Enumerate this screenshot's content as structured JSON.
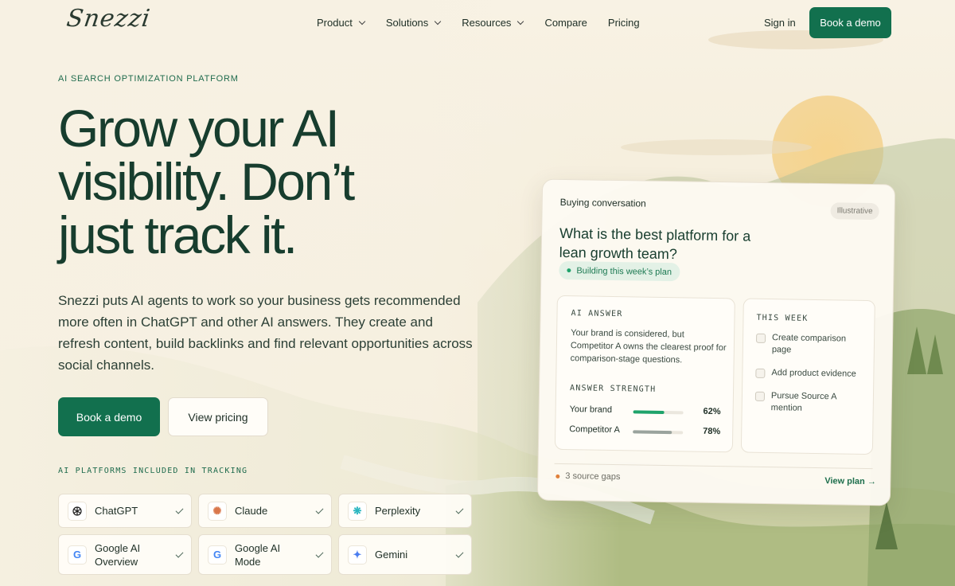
{
  "nav": {
    "logo": "Snezzi",
    "menu": [
      {
        "label": "Product",
        "dropdown": true
      },
      {
        "label": "Solutions",
        "dropdown": true
      },
      {
        "label": "Resources",
        "dropdown": true
      },
      {
        "label": "Compare",
        "dropdown": false
      },
      {
        "label": "Pricing",
        "dropdown": false
      }
    ],
    "signin": "Sign in",
    "demo": "Book a demo"
  },
  "hero": {
    "eyebrow": "AI SEARCH OPTIMIZATION PLATFORM",
    "headline": [
      "Grow your AI",
      "visibility. Don’t",
      "just track it."
    ],
    "lead": "Snezzi puts AI agents to work so your business gets recommended more often in ChatGPT and other AI answers. They create and refresh content, build backlinks and find relevant opportunities across social channels.",
    "cta_primary": "Book a demo",
    "cta_secondary": "View pricing"
  },
  "platforms": {
    "title": "AI PLATFORMS INCLUDED IN TRACKING",
    "items": [
      {
        "name": "ChatGPT",
        "icon": "openai-icon",
        "color": "#1d1d1d"
      },
      {
        "name": "Claude",
        "icon": "claude-icon",
        "color": "#d9774b"
      },
      {
        "name": "Perplexity",
        "icon": "perplexity-icon",
        "color": "#2ab6c0"
      },
      {
        "name": "Google AI Overview",
        "icon": "google-icon",
        "color": "#4285f4"
      },
      {
        "name": "Google AI Mode",
        "icon": "google-icon",
        "color": "#4285f4"
      },
      {
        "name": "Gemini",
        "icon": "gemini-icon",
        "color": "#4a7df0"
      }
    ]
  },
  "card": {
    "label": "Buying conversation",
    "badge": "Illustrative",
    "question": "What is the best platform for a lean growth team?",
    "pill": "Building this week’s plan",
    "answer_title": "AI ANSWER",
    "answer_text": "Your brand is considered, but Competitor A owns the clearest proof for comparison-stage questions.",
    "strength_title": "ANSWER STRENGTH",
    "strength": [
      {
        "name": "Your brand",
        "value": 62,
        "label": "62%",
        "color": "#1fa36b"
      },
      {
        "name": "Competitor A",
        "value": 78,
        "label": "78%",
        "color": "#9aa39d"
      }
    ],
    "week_title": "THIS WEEK",
    "tasks": [
      "Create comparison page",
      "Add product evidence",
      "Pursue Source A mention"
    ],
    "gaps": "3 source gaps",
    "link": "View plan →"
  },
  "colors": {
    "brand": "#12704e",
    "heading": "#173d2e"
  }
}
